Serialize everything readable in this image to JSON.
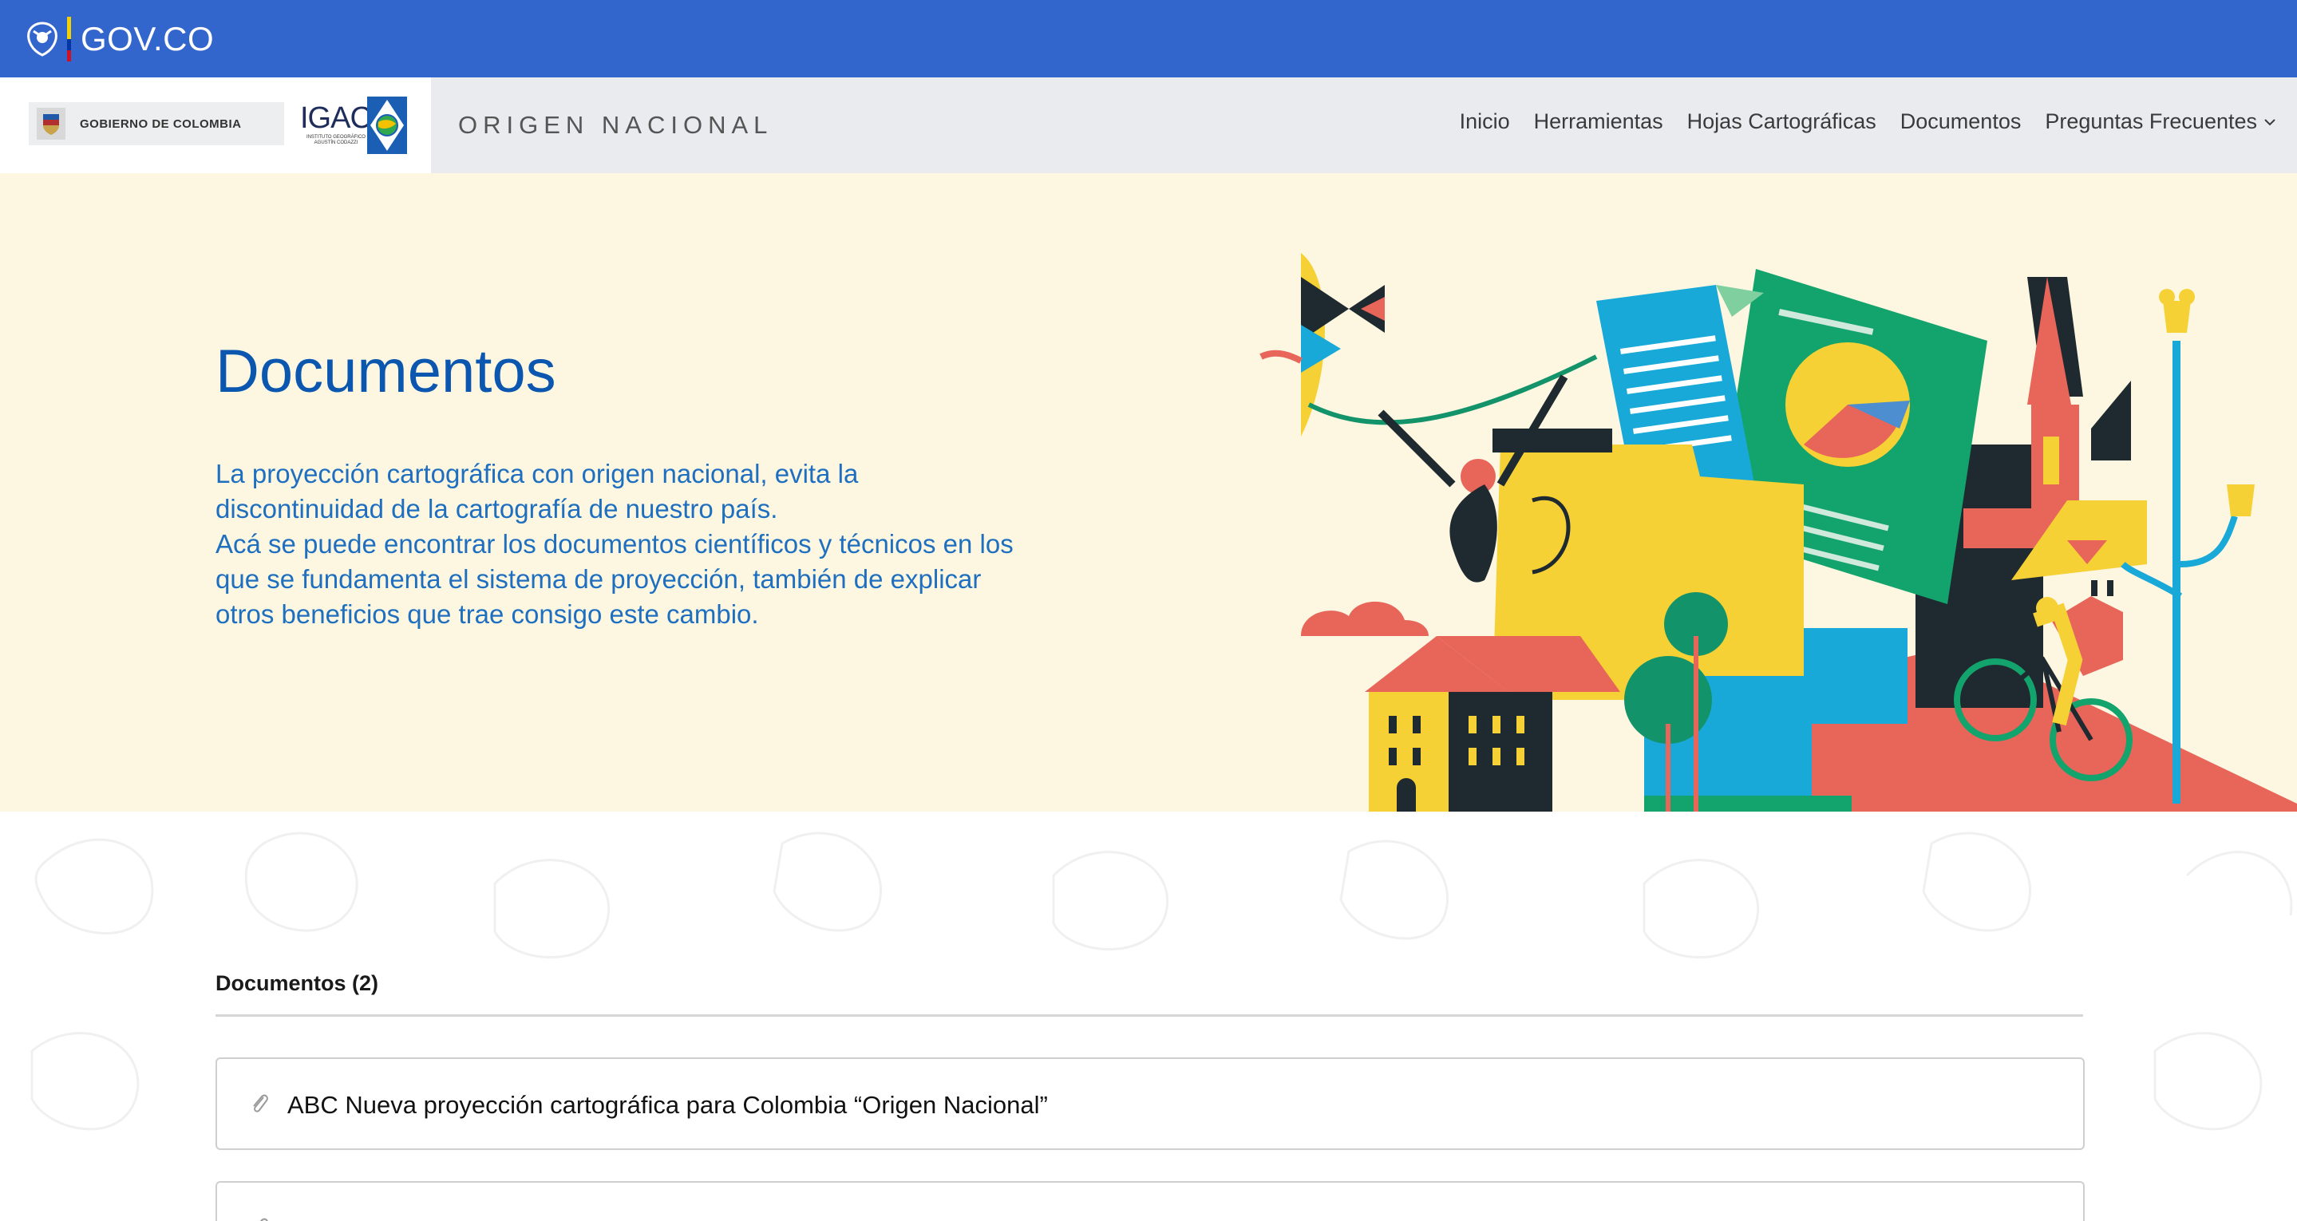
{
  "govbar": {
    "label": "GOV.CO",
    "crest_icon": "colombia-crest-icon"
  },
  "header": {
    "gobierno_label": "GOBIERNO DE COLOMBIA",
    "igac_label": "IGAC",
    "igac_sub": "INSTITUTO GEOGRÁFICO AGUSTÍN CODAZZI",
    "site_name": "ORIGEN NACIONAL",
    "nav": [
      "Inicio",
      "Herramientas",
      "Hojas Cartográficas",
      "Documentos",
      "Preguntas Frecuentes"
    ]
  },
  "hero": {
    "title": "Documentos",
    "description_1": "La proyección cartográfica con origen nacional, evita la discontinuidad de la cartografía de nuestro país.",
    "description_2": "Acá se puede encontrar los documentos científicos y técnicos en los que se fundamenta el sistema de proyección, también de explicar otros beneficios que trae consigo este cambio."
  },
  "documents": {
    "count_label": "Documentos (2)",
    "items": [
      {
        "title": "ABC Nueva proyección cartográfica para Colombia “Origen Nacional”",
        "icon": "paperclip-icon"
      },
      {
        "title": "",
        "icon": "paperclip-icon"
      }
    ]
  },
  "colors": {
    "govbar": "#3366cc",
    "header_bg": "#e9ebee",
    "hero_bg": "#fdf7e1",
    "title_blue": "#0b57b0",
    "text_blue": "#1e6fbf"
  }
}
